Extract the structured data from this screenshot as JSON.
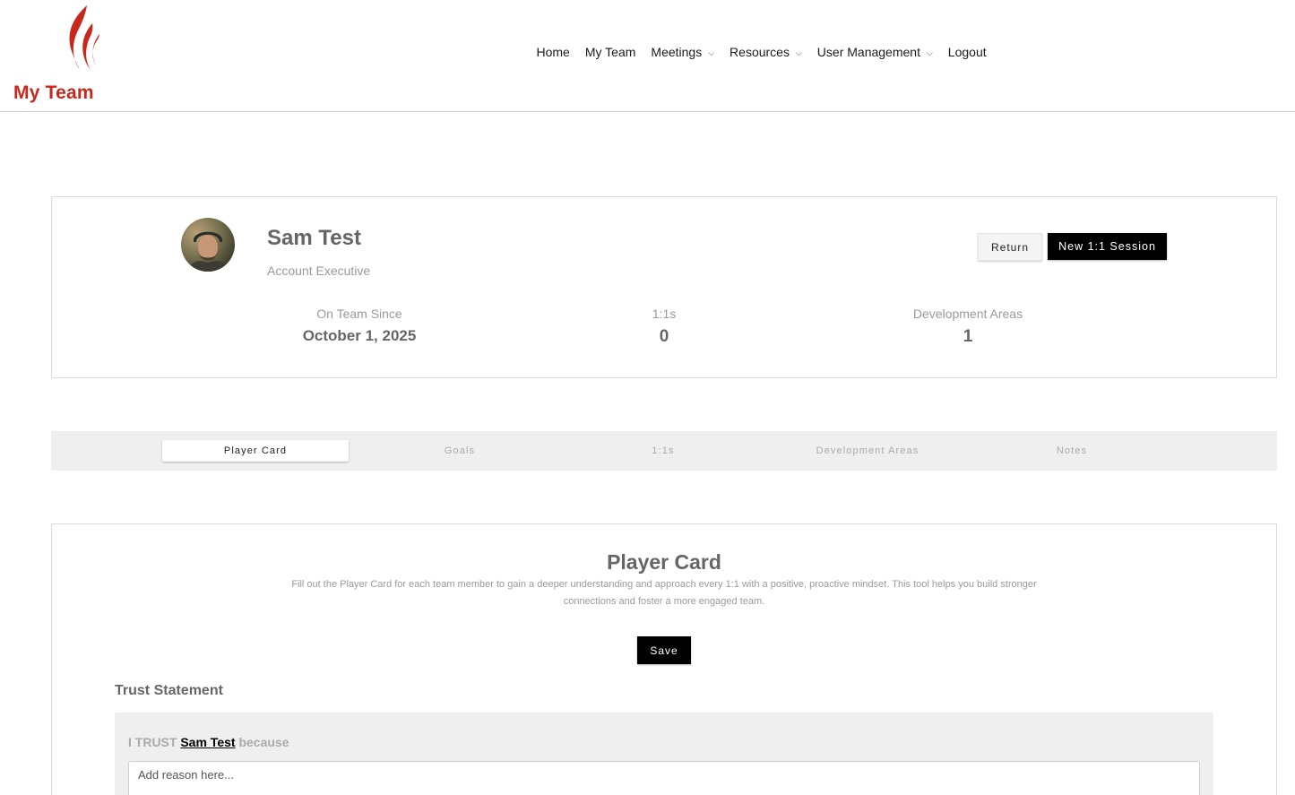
{
  "brand": {
    "name": "My Team",
    "color": "#c8281c",
    "logo_icon": "flame-icon"
  },
  "nav": {
    "items": [
      {
        "label": "Home",
        "dropdown": false
      },
      {
        "label": "My Team",
        "dropdown": false
      },
      {
        "label": "Meetings",
        "dropdown": true
      },
      {
        "label": "Resources",
        "dropdown": true
      },
      {
        "label": "User Management",
        "dropdown": true
      },
      {
        "label": "Logout",
        "dropdown": false
      }
    ],
    "chevron": "⌄"
  },
  "profile": {
    "name": "Sam Test",
    "role": "Account Executive",
    "avatar_icon": "user-avatar",
    "return_label": "Return",
    "new_session_label": "New 1:1 Session",
    "stats": [
      {
        "label": "On Team Since",
        "value": "October 1, 2025"
      },
      {
        "label": "1:1s",
        "value": "0"
      },
      {
        "label": "Development Areas",
        "value": "1"
      }
    ]
  },
  "tabs": {
    "items": [
      "Player Card",
      "Goals",
      "1:1s",
      "Development Areas",
      "Notes"
    ],
    "active_index": 0
  },
  "player_card": {
    "title": "Player Card",
    "description": "Fill out the Player Card for each team member to gain a deeper understanding and approach every 1:1 with a positive, proactive mindset. This tool helps you build stronger connections and foster a more engaged team.",
    "save_label": "Save",
    "trust": {
      "heading": "Trust Statement",
      "prefix": "I TRUST",
      "name": "Sam Test",
      "suffix": "because",
      "input_value": "",
      "input_placeholder": "Add reason here..."
    }
  }
}
